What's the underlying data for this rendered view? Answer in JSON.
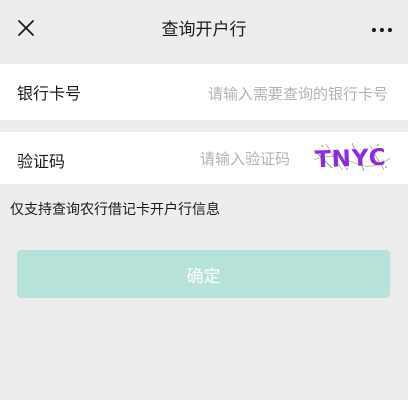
{
  "header": {
    "title": "查询开户行",
    "close_icon": "close-icon",
    "more_icon": "more-dots-icon"
  },
  "form": {
    "card_number": {
      "label": "银行卡号",
      "value": "",
      "placeholder": "请输入需要查询的银行卡号"
    },
    "verification_code": {
      "label": "验证码",
      "value": "",
      "placeholder": "请输入验证码",
      "captcha_text": "TNYC"
    }
  },
  "notice": "仅支持查询农行借记卡开户行信息",
  "confirm_button": {
    "label": "确定",
    "state": "disabled"
  },
  "colors": {
    "background": "#ededed",
    "card_background": "#ffffff",
    "button_disabled": "#b7e2d9",
    "placeholder": "#b2b2b2",
    "captcha_accent": "#8a2be2"
  }
}
